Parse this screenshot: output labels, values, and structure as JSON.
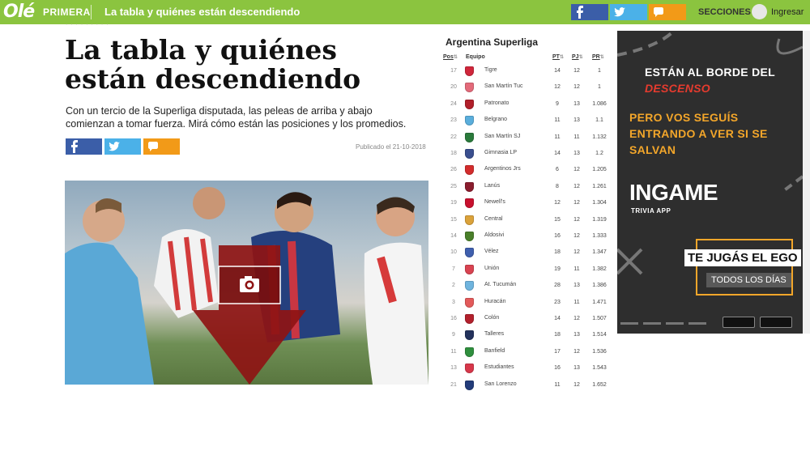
{
  "header": {
    "logo": "Olé",
    "section": "PRIMERA",
    "title": "La tabla y quiénes están descendiendo",
    "menu_label": "SECCIONES",
    "login_label": "Ingresar"
  },
  "article": {
    "headline": "La tabla y quiénes están descendiendo",
    "lede": "Con un tercio de la Superliga disputada, las peleas de arriba y abajo comienzan a tomar fuerza. Mirá cómo están las posiciones y los promedios.",
    "published": "Publicado el 21-10-2018"
  },
  "table": {
    "title": "Argentina Superliga",
    "columns": {
      "pos": "Pos",
      "team": "Equipo",
      "pt": "PT",
      "pj": "PJ",
      "pr": "PR"
    },
    "rows": [
      {
        "pos": "17",
        "team": "Tigre",
        "pt": "14",
        "pj": "12",
        "pr": "1",
        "color": "#d0263b"
      },
      {
        "pos": "20",
        "team": "San Martín Tuc",
        "pt": "12",
        "pj": "12",
        "pr": "1",
        "color": "#e36a7a"
      },
      {
        "pos": "24",
        "team": "Patronato",
        "pt": "9",
        "pj": "13",
        "pr": "1.086",
        "color": "#b11f2a"
      },
      {
        "pos": "23",
        "team": "Belgrano",
        "pt": "11",
        "pj": "13",
        "pr": "1.1",
        "color": "#5aaedc"
      },
      {
        "pos": "22",
        "team": "San Martín SJ",
        "pt": "11",
        "pj": "11",
        "pr": "1.132",
        "color": "#2a7a3b"
      },
      {
        "pos": "18",
        "team": "Gimnasia LP",
        "pt": "14",
        "pj": "13",
        "pr": "1.2",
        "color": "#3a4f8f"
      },
      {
        "pos": "26",
        "team": "Argentinos Jrs",
        "pt": "6",
        "pj": "12",
        "pr": "1.205",
        "color": "#d32c2c"
      },
      {
        "pos": "25",
        "team": "Lanús",
        "pt": "8",
        "pj": "12",
        "pr": "1.261",
        "color": "#8a1d2e"
      },
      {
        "pos": "19",
        "team": "Newell's",
        "pt": "12",
        "pj": "12",
        "pr": "1.304",
        "color": "#c8102e"
      },
      {
        "pos": "15",
        "team": "Central",
        "pt": "15",
        "pj": "12",
        "pr": "1.319",
        "color": "#dba23a"
      },
      {
        "pos": "14",
        "team": "Aldosivi",
        "pt": "16",
        "pj": "12",
        "pr": "1.333",
        "color": "#4a7f2a"
      },
      {
        "pos": "10",
        "team": "Vélez",
        "pt": "18",
        "pj": "12",
        "pr": "1.347",
        "color": "#3f5fae"
      },
      {
        "pos": "7",
        "team": "Unión",
        "pt": "19",
        "pj": "11",
        "pr": "1.382",
        "color": "#d94351"
      },
      {
        "pos": "2",
        "team": "At. Tucumán",
        "pt": "28",
        "pj": "13",
        "pr": "1.386",
        "color": "#6fb4de"
      },
      {
        "pos": "3",
        "team": "Huracán",
        "pt": "23",
        "pj": "11",
        "pr": "1.471",
        "color": "#e35a5a"
      },
      {
        "pos": "16",
        "team": "Colón",
        "pt": "14",
        "pj": "12",
        "pr": "1.507",
        "color": "#b3202c"
      },
      {
        "pos": "9",
        "team": "Talleres",
        "pt": "18",
        "pj": "13",
        "pr": "1.514",
        "color": "#23325c"
      },
      {
        "pos": "11",
        "team": "Banfield",
        "pt": "17",
        "pj": "12",
        "pr": "1.536",
        "color": "#2f8f3e"
      },
      {
        "pos": "13",
        "team": "Estudiantes",
        "pt": "16",
        "pj": "13",
        "pr": "1.543",
        "color": "#d7374a"
      },
      {
        "pos": "21",
        "team": "San Lorenzo",
        "pt": "11",
        "pj": "12",
        "pr": "1.652",
        "color": "#233c7a"
      }
    ]
  },
  "ad": {
    "line1": "ESTÁN AL BORDE DEL",
    "line2": "DESCENSO",
    "line3": "PERO VOS SEGUÍS ENTRANDO A VER SI SE SALVAN",
    "brand": "INGAME",
    "brand_sub": "TRIVIA APP",
    "ego": "TE JUGÁS EL EGO",
    "days": "TODOS LOS DÍAS"
  },
  "colors": {
    "topbar": "#8bc43f",
    "facebook": "#3b5ea8",
    "twitter": "#4bb1e8",
    "comments": "#f29a18",
    "ad_orange": "#f3a62a",
    "ad_red": "#e63b2e"
  },
  "icons": [
    "facebook-icon",
    "twitter-icon",
    "comment-icon",
    "camera-icon",
    "arrow-down-icon"
  ]
}
